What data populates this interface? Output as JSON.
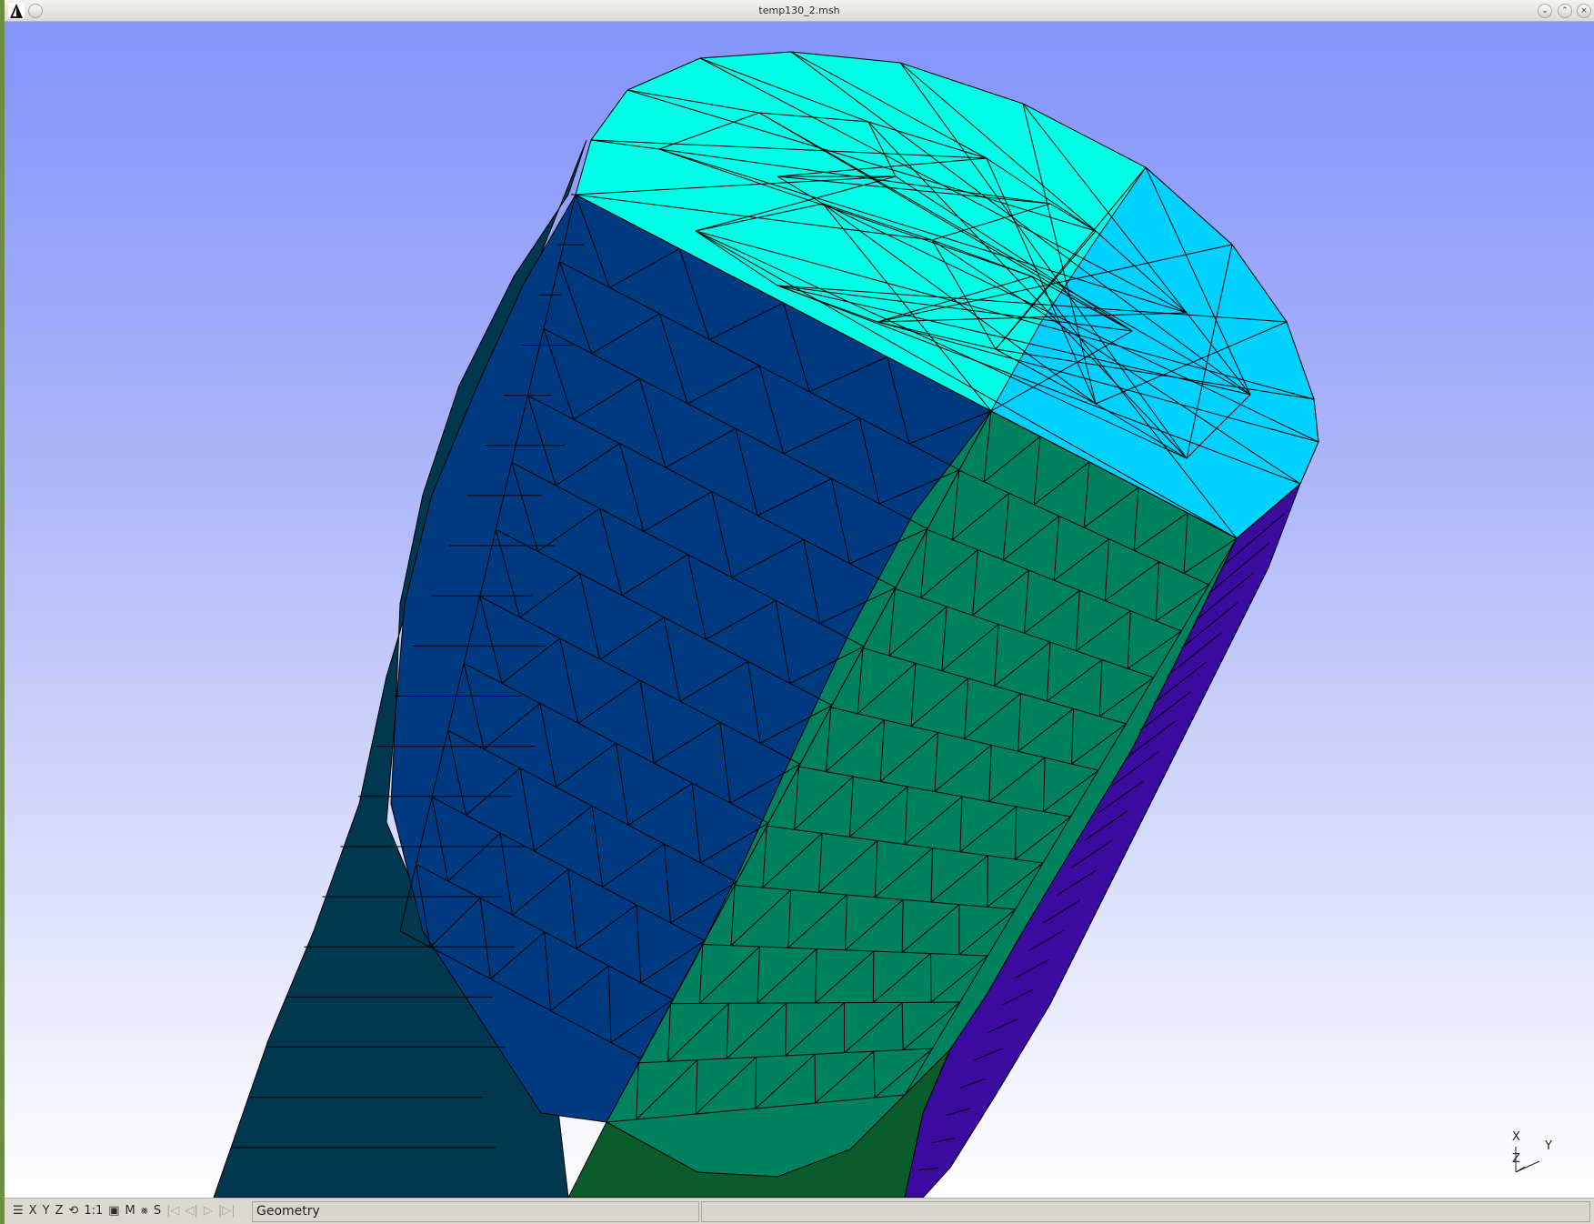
{
  "window": {
    "title": "temp130_2.msh",
    "controls": [
      "minimize",
      "maximize",
      "close"
    ]
  },
  "viewport": {
    "background_top": "#8394fb",
    "background_bottom": "#ffffff",
    "mesh_colors": {
      "top_cap": "#00ffe6",
      "top_cap_right": "#00d2ff",
      "blue_face": "#003b82",
      "green_face": "#008260",
      "shadow_side": "#02384f",
      "purple_side": "#3a0b9e",
      "dark_green_band": "#0a5c2c"
    },
    "axes": {
      "x": "X",
      "y": "Y",
      "z": "Z"
    }
  },
  "statusbar": {
    "buttons": [
      {
        "name": "menu-icon",
        "label": "☰"
      },
      {
        "name": "x-view-button",
        "label": "X"
      },
      {
        "name": "y-view-button",
        "label": "Y"
      },
      {
        "name": "z-view-button",
        "label": "Z"
      },
      {
        "name": "rotate-icon",
        "label": "⟲"
      },
      {
        "name": "scale-one-button",
        "label": "1:1"
      },
      {
        "name": "projection-icon",
        "label": "▣"
      },
      {
        "name": "mesh-button",
        "label": "M"
      },
      {
        "name": "axes-icon",
        "label": "⨳"
      },
      {
        "name": "select-button",
        "label": "S"
      },
      {
        "name": "first-step-icon",
        "label": "|◁"
      },
      {
        "name": "prev-step-icon",
        "label": "◁|"
      },
      {
        "name": "play-icon",
        "label": "▷"
      },
      {
        "name": "last-step-icon",
        "label": "|▷|"
      }
    ],
    "status_text": "Geometry"
  }
}
